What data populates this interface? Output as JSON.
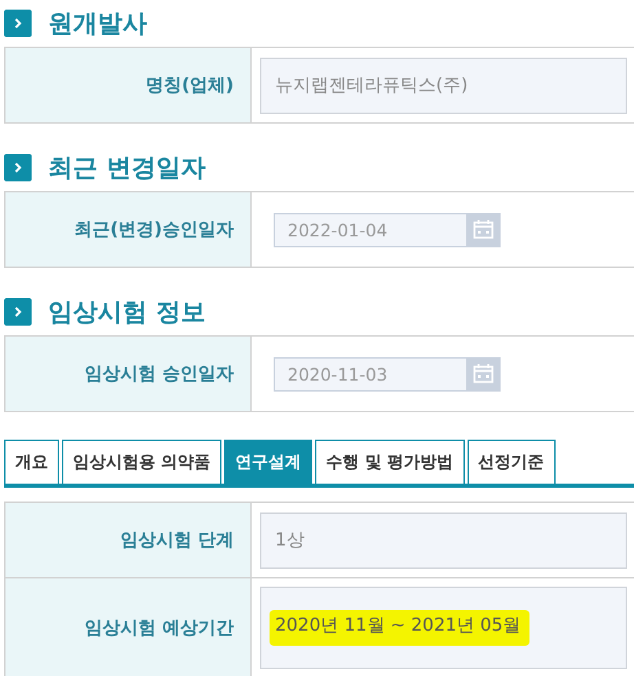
{
  "sections": [
    {
      "title": "원개발사",
      "fields": [
        {
          "kind": "text",
          "label": "명칭(업체)",
          "value": "뉴지랩젠테라퓨틱스(주)"
        }
      ]
    },
    {
      "title": "최근 변경일자",
      "fields": [
        {
          "kind": "date",
          "label": "최근(변경)승인일자",
          "value": "2022-01-04"
        }
      ]
    },
    {
      "title": "임상시험 정보",
      "fields": [
        {
          "kind": "date",
          "label": "임상시험 승인일자",
          "value": "2020-11-03"
        }
      ]
    }
  ],
  "tabs": [
    {
      "label": "개요",
      "selected": false
    },
    {
      "label": "임상시험용 의약품",
      "selected": false
    },
    {
      "label": "연구설계",
      "selected": true
    },
    {
      "label": "수행 및 평가방법",
      "selected": false
    },
    {
      "label": "선정기준",
      "selected": false
    }
  ],
  "details": [
    {
      "label": "임상시험 단계",
      "value": "1상",
      "highlighted": false
    },
    {
      "label": "임상시험 예상기간",
      "value": "2020년 11월 ~ 2021년 05월",
      "highlighted": true
    }
  ]
}
